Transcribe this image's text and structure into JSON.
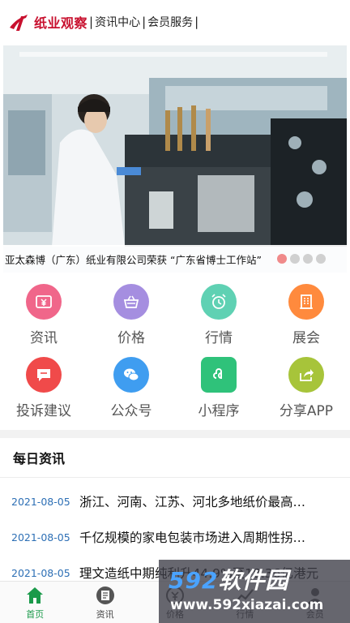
{
  "header": {
    "brand": "纸业观察",
    "nav": [
      {
        "label": "资讯中心"
      },
      {
        "label": "会员服务"
      }
    ],
    "separator": "|"
  },
  "banner": {
    "caption": "亚太森博（广东）纸业有限公司荣获 “广东省博士工作站”",
    "active_slide": 1,
    "slide_count": 4
  },
  "grid": [
    {
      "label": "资讯",
      "icon": "yuan-bill-icon",
      "color": "#f0668a"
    },
    {
      "label": "价格",
      "icon": "basket-icon",
      "color": "#a58ee0"
    },
    {
      "label": "行情",
      "icon": "alarm-clock-icon",
      "color": "#5fd1b3"
    },
    {
      "label": "展会",
      "icon": "building-icon",
      "color": "#ff8a3d"
    },
    {
      "label": "投诉建议",
      "icon": "chat-bubble-icon",
      "color": "#f04a4a"
    },
    {
      "label": "公众号",
      "icon": "wechat-icon",
      "color": "#3f9df0"
    },
    {
      "label": "小程序",
      "icon": "mini-program-icon",
      "color": "#2fc27a"
    },
    {
      "label": "分享APP",
      "icon": "share-icon",
      "color": "#a7c43a"
    }
  ],
  "news": {
    "title": "每日资讯",
    "items": [
      {
        "date": "2021-08-05",
        "text": "浙江、河南、江苏、河北多地纸价最高…"
      },
      {
        "date": "2021-08-05",
        "text": "千亿规模的家电包装市场进入周期性拐…"
      },
      {
        "date": "2021-08-05",
        "text": "理文造纸中期纯利升44.9%至18.36亿港元"
      }
    ]
  },
  "watermark": {
    "num": "592",
    "text": "软件园",
    "url": "www.592xiazai.com"
  },
  "tabbar": [
    {
      "label": "首页",
      "icon": "home-icon",
      "active": true
    },
    {
      "label": "资讯",
      "icon": "news-icon",
      "active": false
    },
    {
      "label": "价格",
      "icon": "price-icon",
      "active": false
    },
    {
      "label": "行情",
      "icon": "trend-icon",
      "active": false
    },
    {
      "label": "会员",
      "icon": "member-icon",
      "active": false
    }
  ],
  "colors": {
    "brand_red": "#c8102e",
    "date_blue": "#2d6fb5",
    "tab_active_green": "#1a9a4a"
  }
}
